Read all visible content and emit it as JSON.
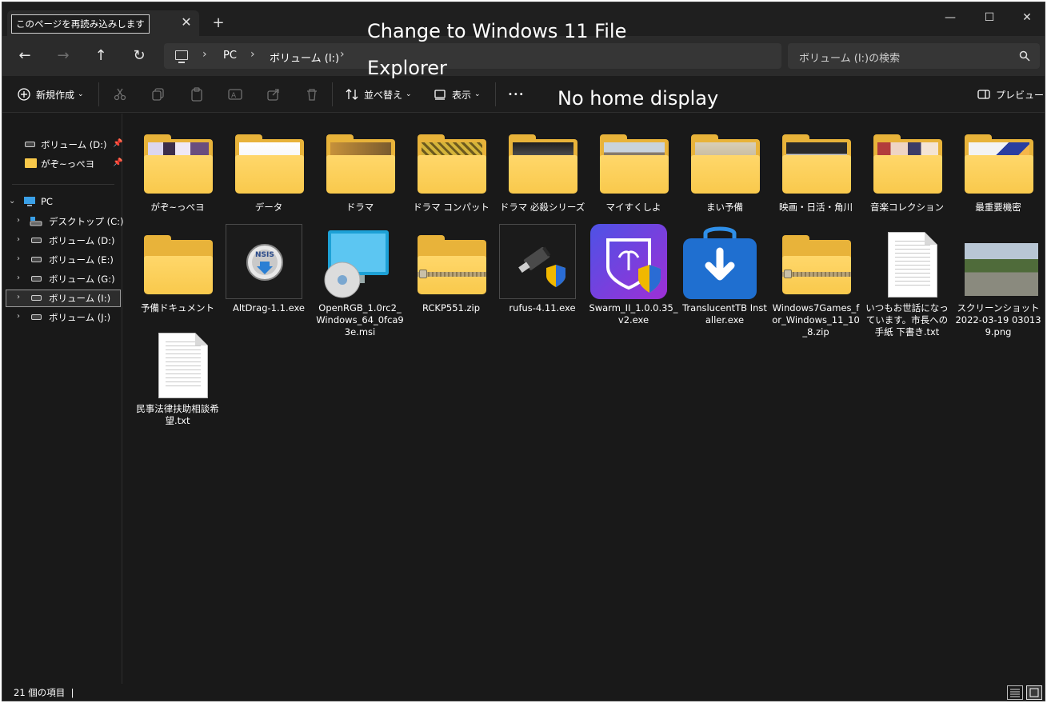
{
  "tab": {
    "title": "このページを再読み込みします",
    "close": "✕",
    "new": "+"
  },
  "window_controls": {
    "minimize": "—",
    "maximize": "☐",
    "close": "✕"
  },
  "nav": {
    "back": "←",
    "forward": "→",
    "up": "↑",
    "refresh": "↻"
  },
  "breadcrumb": [
    "PC",
    "ボリューム (I:)"
  ],
  "breadcrumb_sep": "›",
  "search": {
    "placeholder": "ボリューム (I:)の検索"
  },
  "toolbar": {
    "new_label": "新規作成",
    "sort_label": "並べ替え",
    "view_label": "表示",
    "more_label": "•••",
    "preview_label": "プレビュー"
  },
  "overlay": {
    "line1": "Change to Windows 11 File",
    "line2": "Explorer",
    "line3": "No home display"
  },
  "sidebar": {
    "pinned": [
      {
        "label": "ボリューム (D:)",
        "icon": "drive-icon"
      },
      {
        "label": "がぞ~っぺヨ",
        "icon": "folder-icon"
      }
    ],
    "pc_label": "PC",
    "drives": [
      {
        "label": "デスクトップ (C:)",
        "icon": "desktop-drive-icon"
      },
      {
        "label": "ボリューム (D:)",
        "icon": "drive-icon"
      },
      {
        "label": "ボリューム (E:)",
        "icon": "drive-icon"
      },
      {
        "label": "ボリューム (G:)",
        "icon": "drive-icon"
      },
      {
        "label": "ボリューム (I:)",
        "icon": "drive-icon",
        "selected": true
      },
      {
        "label": "ボリューム (J:)",
        "icon": "drive-icon"
      }
    ]
  },
  "items": [
    {
      "label": "がぞ~っぺヨ",
      "kind": "folder",
      "preview": "anime-art"
    },
    {
      "label": "データ",
      "kind": "folder",
      "preview": "document"
    },
    {
      "label": "ドラマ",
      "kind": "folder",
      "preview": "brown-gradient"
    },
    {
      "label": "ドラマ コンパット",
      "kind": "folder",
      "preview": "yellow-pattern"
    },
    {
      "label": "ドラマ 必殺シリーズ",
      "kind": "folder",
      "preview": "dark-photo"
    },
    {
      "label": "マイすくしよ",
      "kind": "folder",
      "preview": "house-photo"
    },
    {
      "label": "まい予備",
      "kind": "folder",
      "preview": "old-doc"
    },
    {
      "label": "映画・日活・角川",
      "kind": "folder",
      "preview": "gray-disc"
    },
    {
      "label": "音楽コレクション",
      "kind": "folder",
      "preview": "people-photo"
    },
    {
      "label": "最重要機密",
      "kind": "folder",
      "preview": "blue-cover"
    },
    {
      "label": "予備ドキュメント",
      "kind": "folder",
      "preview": "empty"
    },
    {
      "label": "AltDrag-1.1.exe",
      "kind": "nsis"
    },
    {
      "label": "OpenRGB_1.0rc2_Windows_64_0fca93e.msi",
      "kind": "msi"
    },
    {
      "label": "RCKP551.zip",
      "kind": "zip"
    },
    {
      "label": "rufus-4.11.exe",
      "kind": "rufus"
    },
    {
      "label": "Swarm_II_1.0.0.35_v2.exe",
      "kind": "swarm"
    },
    {
      "label": "TranslucentTB Installer.exe",
      "kind": "bag"
    },
    {
      "label": "Windows7Games_for_Windows_11_10_8.zip",
      "kind": "zip"
    },
    {
      "label": "いつもお世話になっています。市長への手紙 下書き.txt",
      "kind": "txt"
    },
    {
      "label": "スクリーンショット 2022-03-19 030139.png",
      "kind": "png"
    },
    {
      "label": "民事法律扶助相談希望.txt",
      "kind": "txt"
    }
  ],
  "status": {
    "count_text": "21 個の項目",
    "cursor": "|"
  },
  "colors": {
    "folder": "#f9c94c",
    "bg": "#191919",
    "accent": "#0078d4"
  }
}
